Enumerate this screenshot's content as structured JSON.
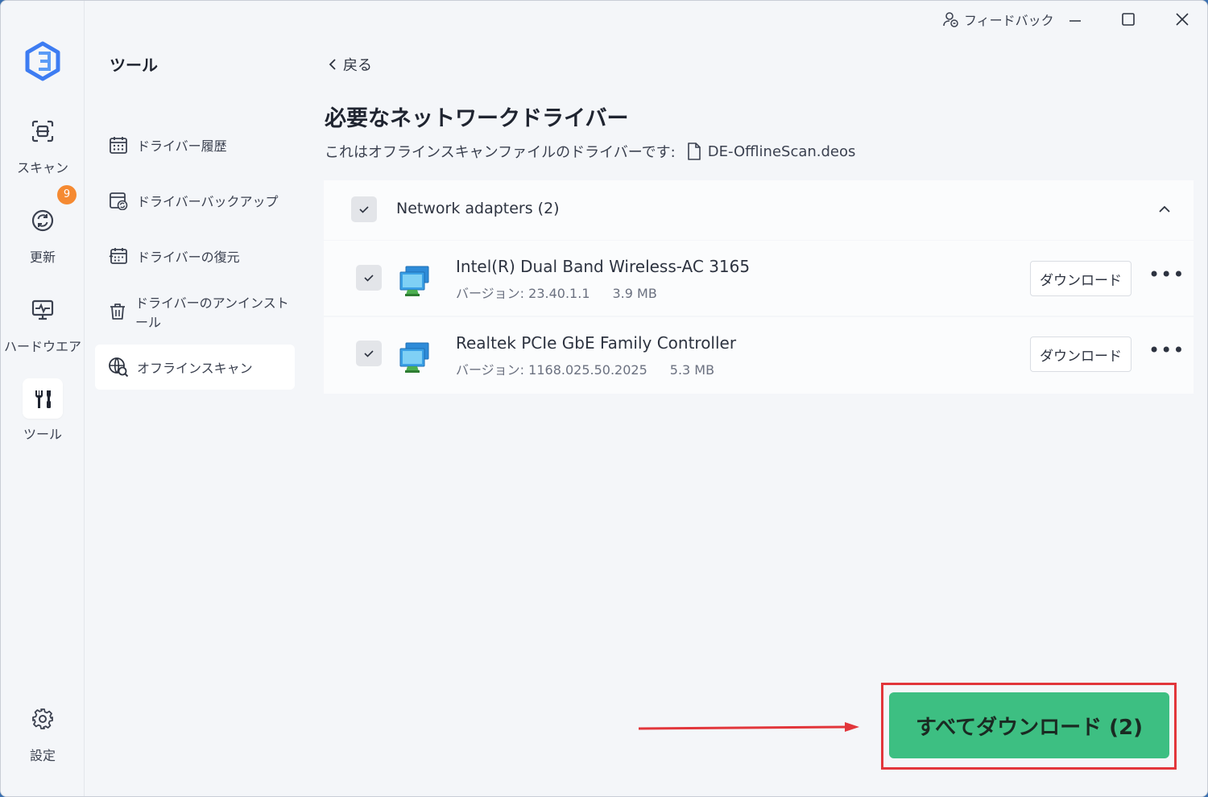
{
  "window": {
    "feedback_label": "フィードバック",
    "minimize_icon": "minimize-icon",
    "maximize_icon": "maximize-icon",
    "close_icon": "close-icon"
  },
  "rail": {
    "items": [
      {
        "label": "スキャン",
        "icon": "scan-icon"
      },
      {
        "label": "更新",
        "icon": "update-icon",
        "badge": "9"
      },
      {
        "label": "ハードウエア",
        "icon": "hardware-icon"
      },
      {
        "label": "ツール",
        "icon": "tools-icon",
        "active": true
      }
    ],
    "settings_label": "設定"
  },
  "tools": {
    "title": "ツール",
    "items": [
      {
        "label": "ドライバー履歴",
        "icon": "calendar-icon"
      },
      {
        "label": "ドライバーバックアップ",
        "icon": "backup-icon"
      },
      {
        "label": "ドライバーの復元",
        "icon": "restore-icon"
      },
      {
        "label": "ドライバーのアンインストール",
        "icon": "trash-icon"
      },
      {
        "label": "オフラインスキャン",
        "icon": "offline-scan-icon",
        "active": true
      }
    ]
  },
  "main": {
    "back_label": "戻る",
    "title": "必要なネットワークドライバー",
    "subtitle": "これはオフラインスキャンファイルのドライバーです:",
    "file_name": "DE-OfflineScan.deos",
    "group": {
      "name": "Network adapters (2)",
      "checked": true,
      "expanded": true
    },
    "drivers": [
      {
        "name": "Intel(R) Dual Band Wireless-AC 3165",
        "version": "バージョン: 23.40.1.1",
        "size": "3.9 MB",
        "button": "ダウンロード",
        "checked": true
      },
      {
        "name": "Realtek PCIe GbE Family Controller",
        "version": "バージョン: 1168.025.50.2025",
        "size": "5.3 MB",
        "button": "ダウンロード",
        "checked": true
      }
    ],
    "download_all_label": "すべてダウンロード (2)"
  },
  "colors": {
    "accent_green": "#3dbf82",
    "highlight_red": "#e2363b",
    "badge_orange": "#f58a32",
    "logo_blue": "#3d7cf2"
  }
}
